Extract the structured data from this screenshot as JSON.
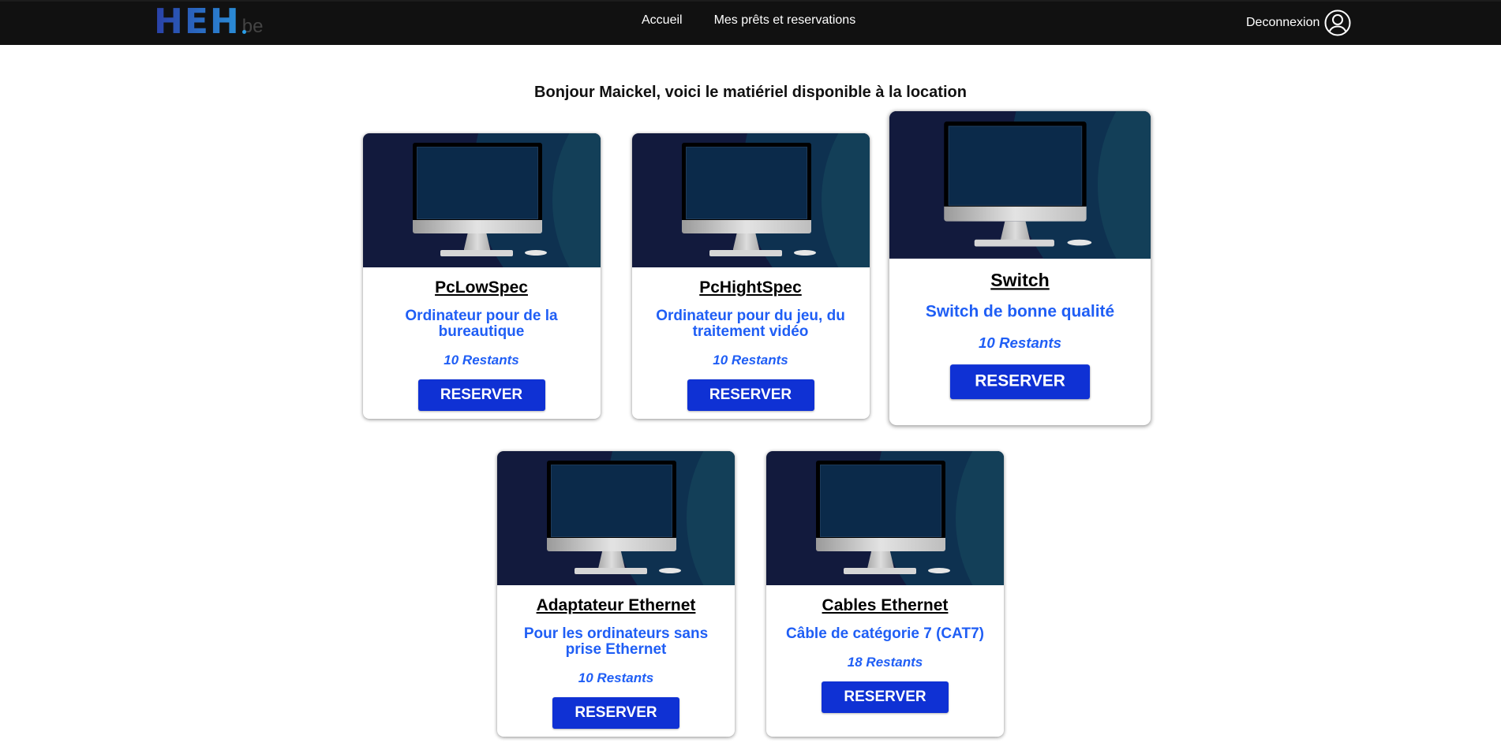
{
  "nav": {
    "logo": "HEH.be",
    "links": [
      "Accueil",
      "Mes prêts et reservations"
    ],
    "logout": "Deconnexion",
    "user_icon": "user-circle-icon"
  },
  "heading": "Bonjour Maickel, voici le matiériel disponible à la location",
  "colors": {
    "navbar": "#111111",
    "accent_text": "#1f5ef5",
    "button": "#0f31d4"
  },
  "items": [
    {
      "title": "PcLowSpec",
      "desc": "Ordinateur pour de la bureautique",
      "remaining": "10 Restants",
      "button": "RESERVER"
    },
    {
      "title": "PcHightSpec",
      "desc": "Ordinateur pour du jeu, du traitement vidéo",
      "remaining": "10 Restants",
      "button": "RESERVER"
    },
    {
      "title": "Switch",
      "desc": "Switch de bonne qualité",
      "remaining": "10 Restants",
      "button": "RESERVER"
    },
    {
      "title": "Adaptateur Ethernet",
      "desc": "Pour les ordinateurs sans prise Ethernet",
      "remaining": "10 Restants",
      "button": "RESERVER"
    },
    {
      "title": "Cables Ethernet",
      "desc": "Câble de catégorie 7 (CAT7)",
      "remaining": "18 Restants",
      "button": "RESERVER"
    }
  ]
}
